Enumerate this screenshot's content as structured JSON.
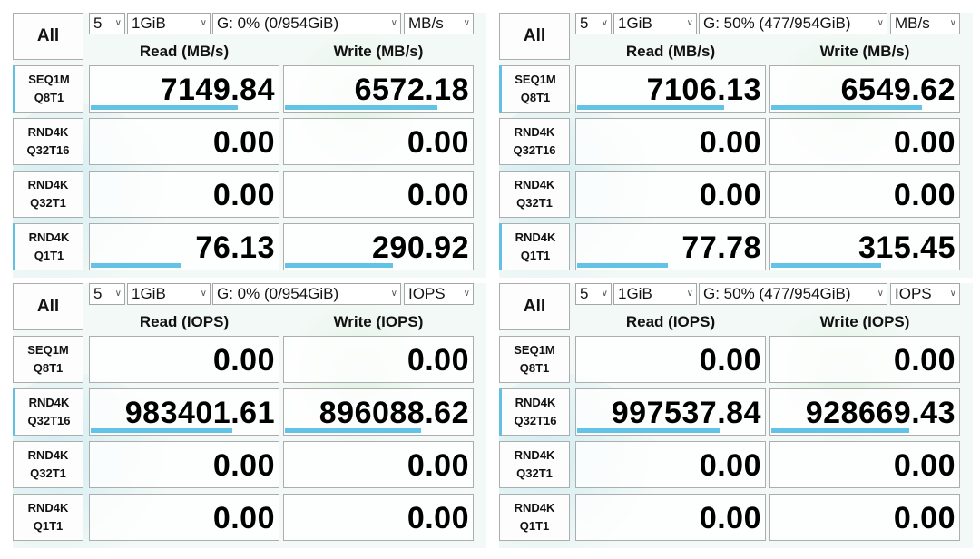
{
  "panels": [
    {
      "all_label": "All",
      "count": "5",
      "size": "1GiB",
      "drive": "G: 0% (0/954GiB)",
      "unit": "MB/s",
      "read_header": "Read (MB/s)",
      "write_header": "Write (MB/s)",
      "rows": [
        {
          "line1": "SEQ1M",
          "line2": "Q8T1",
          "read": "7149.84",
          "write": "6572.18",
          "read_level": 0.78,
          "write_level": 0.81
        },
        {
          "line1": "RND4K",
          "line2": "Q32T16",
          "read": "0.00",
          "write": "0.00",
          "read_level": 0,
          "write_level": 0
        },
        {
          "line1": "RND4K",
          "line2": "Q32T1",
          "read": "0.00",
          "write": "0.00",
          "read_level": 0,
          "write_level": 0
        },
        {
          "line1": "RND4K",
          "line2": "Q1T1",
          "read": "76.13",
          "write": "290.92",
          "read_level": 0.48,
          "write_level": 0.57
        }
      ]
    },
    {
      "all_label": "All",
      "count": "5",
      "size": "1GiB",
      "drive": "G: 50% (477/954GiB)",
      "unit": "MB/s",
      "read_header": "Read (MB/s)",
      "write_header": "Write (MB/s)",
      "rows": [
        {
          "line1": "SEQ1M",
          "line2": "Q8T1",
          "read": "7106.13",
          "write": "6549.62",
          "read_level": 0.78,
          "write_level": 0.8
        },
        {
          "line1": "RND4K",
          "line2": "Q32T16",
          "read": "0.00",
          "write": "0.00",
          "read_level": 0,
          "write_level": 0
        },
        {
          "line1": "RND4K",
          "line2": "Q32T1",
          "read": "0.00",
          "write": "0.00",
          "read_level": 0,
          "write_level": 0
        },
        {
          "line1": "RND4K",
          "line2": "Q1T1",
          "read": "77.78",
          "write": "315.45",
          "read_level": 0.48,
          "write_level": 0.58
        }
      ]
    },
    {
      "all_label": "All",
      "count": "5",
      "size": "1GiB",
      "drive": "G: 0% (0/954GiB)",
      "unit": "IOPS",
      "read_header": "Read (IOPS)",
      "write_header": "Write (IOPS)",
      "rows": [
        {
          "line1": "SEQ1M",
          "line2": "Q8T1",
          "read": "0.00",
          "write": "0.00",
          "read_level": 0,
          "write_level": 0
        },
        {
          "line1": "RND4K",
          "line2": "Q32T16",
          "read": "983401.61",
          "write": "896088.62",
          "read_level": 0.75,
          "write_level": 0.72
        },
        {
          "line1": "RND4K",
          "line2": "Q32T1",
          "read": "0.00",
          "write": "0.00",
          "read_level": 0,
          "write_level": 0
        },
        {
          "line1": "RND4K",
          "line2": "Q1T1",
          "read": "0.00",
          "write": "0.00",
          "read_level": 0,
          "write_level": 0
        }
      ]
    },
    {
      "all_label": "All",
      "count": "5",
      "size": "1GiB",
      "drive": "G: 50% (477/954GiB)",
      "unit": "IOPS",
      "read_header": "Read (IOPS)",
      "write_header": "Write (IOPS)",
      "rows": [
        {
          "line1": "SEQ1M",
          "line2": "Q8T1",
          "read": "0.00",
          "write": "0.00",
          "read_level": 0,
          "write_level": 0
        },
        {
          "line1": "RND4K",
          "line2": "Q32T16",
          "read": "997537.84",
          "write": "928669.43",
          "read_level": 0.76,
          "write_level": 0.73
        },
        {
          "line1": "RND4K",
          "line2": "Q32T1",
          "read": "0.00",
          "write": "0.00",
          "read_level": 0,
          "write_level": 0
        },
        {
          "line1": "RND4K",
          "line2": "Q1T1",
          "read": "0.00",
          "write": "0.00",
          "read_level": 0,
          "write_level": 0
        }
      ]
    }
  ],
  "colors": {
    "bar": "#63c3e6",
    "marker": "#62c0e3",
    "border": "#adadad"
  }
}
